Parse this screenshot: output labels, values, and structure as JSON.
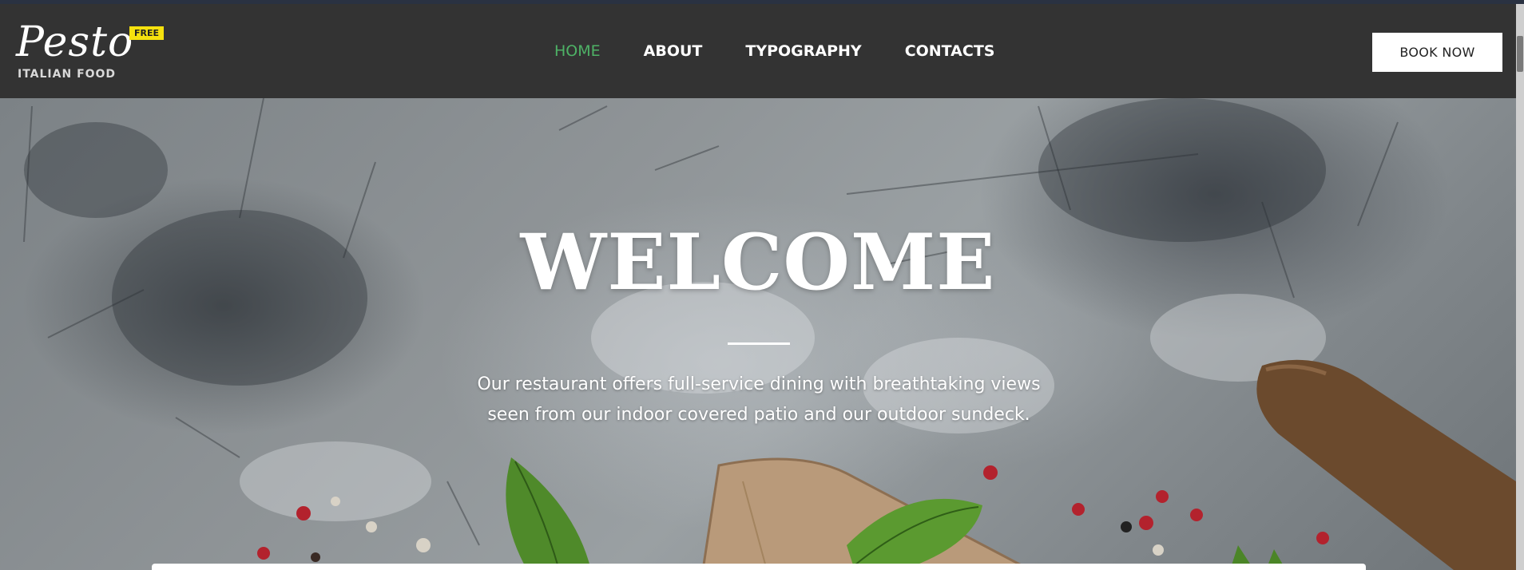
{
  "logo": {
    "name": "Pesto",
    "tagline": "ITALIAN FOOD",
    "badge": "FREE"
  },
  "nav": {
    "items": [
      {
        "label": "HOME",
        "active": true
      },
      {
        "label": "ABOUT",
        "active": false
      },
      {
        "label": "TYPOGRAPHY",
        "active": false
      },
      {
        "label": "CONTACTS",
        "active": false
      }
    ]
  },
  "header": {
    "cta_label": "BOOK NOW"
  },
  "hero": {
    "title": "WELCOME",
    "text_line1": "Our restaurant offers full-service dining with breathtaking views",
    "text_line2": "seen from our indoor covered patio and our outdoor sundeck."
  },
  "colors": {
    "navbar_bg": "#333333",
    "nav_active": "#4eb266",
    "badge_bg": "#f6e10e",
    "button_bg": "#ffffff"
  },
  "icons": {
    "hero_decor": [
      "basil-leaf-icon",
      "cutting-board-icon",
      "rolling-pin-icon",
      "peppercorn-icon"
    ]
  }
}
